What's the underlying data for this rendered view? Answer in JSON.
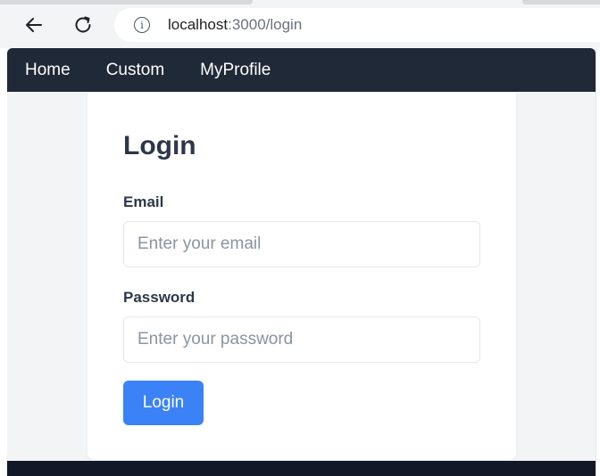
{
  "browser": {
    "url_host": "localhost",
    "url_path": ":3000/login",
    "icons": {
      "back": "arrow-left-icon",
      "reload": "reload-icon",
      "info": "info-icon"
    }
  },
  "navbar": {
    "links": [
      {
        "label": "Home"
      },
      {
        "label": "Custom"
      },
      {
        "label": "MyProfile"
      }
    ]
  },
  "login_form": {
    "title": "Login",
    "email_label": "Email",
    "email_placeholder": "Enter your email",
    "email_value": "",
    "password_label": "Password",
    "password_placeholder": "Enter your password",
    "password_value": "",
    "submit_label": "Login"
  },
  "colors": {
    "navbar_bg": "#1f2937",
    "page_bg": "#f3f4f6",
    "button_bg": "#3b82f6",
    "footer_bg": "#111827"
  }
}
